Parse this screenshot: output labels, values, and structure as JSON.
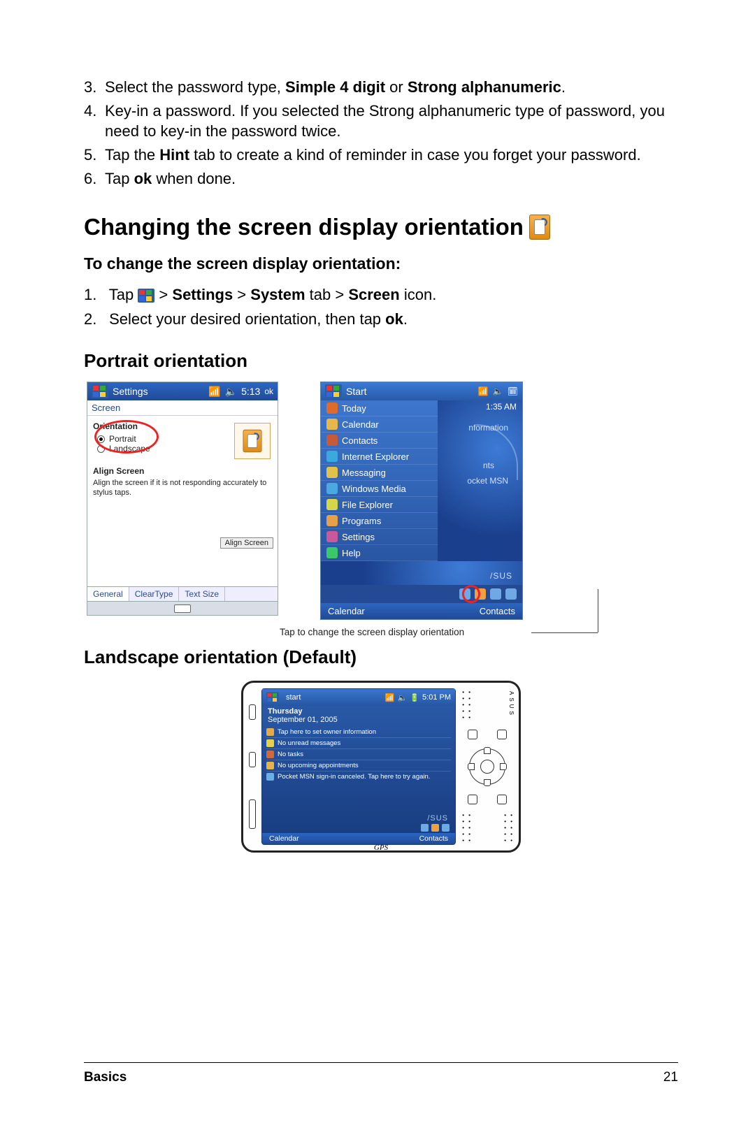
{
  "steps_top": [
    {
      "n": "3.",
      "html": "Select the password type, <b>Simple 4 digit</b> or <b>Strong alphanumeric</b>."
    },
    {
      "n": "4.",
      "html": "Key-in a password. If you selected the Strong alphanumeric type of password, you need to key-in the password twice."
    },
    {
      "n": "5.",
      "html": "Tap the <b>Hint</b> tab to create a kind of reminder in case you forget your password."
    },
    {
      "n": "6.",
      "html": "Tap <b>ok</b> when done."
    }
  ],
  "section_title": "Changing the screen display orientation",
  "sub_heading": "To change the screen display orientation:",
  "steps_small": [
    {
      "n": "1.",
      "prefix": "Tap ",
      "suffix": " > <b>Settings</b> > <b>System</b> tab > <b>Screen</b> icon."
    },
    {
      "n": "2.",
      "html": "Select your desired orientation, then tap <b>ok</b>."
    }
  ],
  "portrait_heading": "Portrait orientation",
  "landscape_heading": "Landscape orientation (Default)",
  "shot1": {
    "title": "Settings",
    "time": "5:13",
    "ok": "ok",
    "subtitle": "Screen",
    "group": "Orientation",
    "opt_portrait": "Portrait",
    "opt_landscape": "Landscape",
    "align_title": "Align Screen",
    "align_desc": "Align the screen if it is not responding accurately to stylus taps.",
    "align_btn": "Align Screen",
    "tabs": [
      "General",
      "ClearType",
      "Text Size"
    ]
  },
  "shot2": {
    "title": "Start",
    "time_top": "",
    "clock": "1:35 AM",
    "items": [
      {
        "label": "Today",
        "color": "#e06a2a"
      },
      {
        "label": "Calendar",
        "color": "#e6b84a"
      },
      {
        "label": "Contacts",
        "color": "#c85a3a"
      },
      {
        "label": "Internet Explorer",
        "color": "#3aa9e0"
      },
      {
        "label": "Messaging",
        "color": "#e0c24a"
      },
      {
        "label": "Windows Media",
        "color": "#4aa9e0"
      },
      {
        "label": "File Explorer",
        "color": "#d6d64a"
      },
      {
        "label": "Programs",
        "color": "#e6a04a"
      },
      {
        "label": "Settings",
        "color": "#c85a9c"
      },
      {
        "label": "Help",
        "color": "#3ac96a"
      }
    ],
    "bg_text1": "nformation",
    "bg_text2": "nts",
    "bg_text3": "ocket MSN",
    "asus": "/SUS",
    "soft_left": "Calendar",
    "soft_right": "Contacts"
  },
  "caption": "Tap to change the screen display orientation",
  "device": {
    "start": "start",
    "day": "Thursday",
    "date": "September 01, 2005",
    "time": "5:01 PM",
    "rows": [
      "Tap here to set owner information",
      "No unread messages",
      "No tasks",
      "No upcoming appointments",
      "Pocket MSN sign-in canceled. Tap here to try again."
    ],
    "asus": "/SUS",
    "soft_left": "Calendar",
    "soft_right": "Contacts",
    "gps": "GPS",
    "brand": "ASUS"
  },
  "footer": {
    "section": "Basics",
    "page": "21"
  }
}
